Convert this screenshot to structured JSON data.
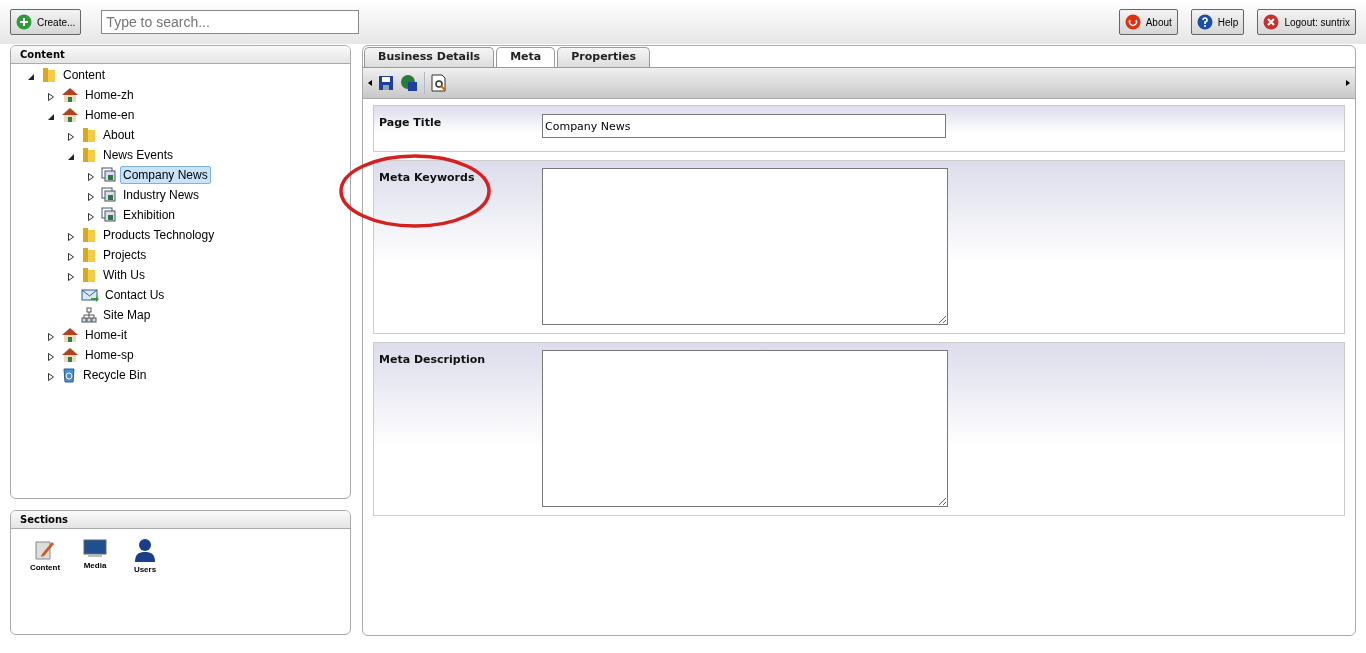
{
  "topbar": {
    "create_button": "Create...",
    "search": {
      "placeholder": "Type to search..."
    },
    "buttons": [
      {
        "label": "About",
        "kind": "about"
      },
      {
        "label": "Help",
        "kind": "help"
      },
      {
        "label": "Logout: suntrix",
        "kind": "logout"
      }
    ]
  },
  "content_panel": {
    "title": "Content",
    "tree": [
      {
        "label": "Content",
        "kind": "folder",
        "expanded": true,
        "selected": false,
        "children": [
          {
            "label": "Home-zh",
            "kind": "home",
            "expanded": false,
            "selected": false
          },
          {
            "label": "Home-en",
            "kind": "home",
            "expanded": true,
            "selected": false,
            "children": [
              {
                "label": "About",
                "kind": "folder",
                "expanded": false,
                "selected": false
              },
              {
                "label": "News Events",
                "kind": "folder",
                "expanded": true,
                "selected": false,
                "children": [
                  {
                    "label": "Company News",
                    "kind": "pages",
                    "expanded": false,
                    "selected": true
                  },
                  {
                    "label": "Industry News",
                    "kind": "pages",
                    "expanded": false,
                    "selected": false
                  },
                  {
                    "label": "Exhibition",
                    "kind": "pages",
                    "expanded": false,
                    "selected": false
                  }
                ]
              },
              {
                "label": "Products Technology",
                "kind": "folder",
                "expanded": false,
                "selected": false
              },
              {
                "label": "Projects",
                "kind": "folder",
                "expanded": false,
                "selected": false
              },
              {
                "label": "With Us",
                "kind": "folder",
                "expanded": false,
                "selected": false
              },
              {
                "label": "Contact Us",
                "kind": "mail",
                "selected": false
              },
              {
                "label": "Site Map",
                "kind": "sitemap",
                "selected": false
              }
            ]
          },
          {
            "label": "Home-it",
            "kind": "home",
            "expanded": false,
            "selected": false
          },
          {
            "label": "Home-sp",
            "kind": "home",
            "expanded": false,
            "selected": false
          },
          {
            "label": "Recycle Bin",
            "kind": "recycle",
            "expanded": false,
            "selected": false
          }
        ]
      }
    ]
  },
  "sections_panel": {
    "title": "Sections",
    "items": [
      {
        "label": "Content",
        "kind": "content"
      },
      {
        "label": "Media",
        "kind": "media"
      },
      {
        "label": "Users",
        "kind": "users"
      }
    ]
  },
  "tabs": [
    {
      "label": "Business Details",
      "selected": false
    },
    {
      "label": "Meta",
      "selected": true
    },
    {
      "label": "Properties",
      "selected": false
    }
  ],
  "fields": [
    {
      "label": "Page Title",
      "kind": "input",
      "value": "Company News",
      "highlighted": false
    },
    {
      "label": "Meta Keywords",
      "kind": "textarea",
      "highlighted": true
    },
    {
      "label": "Meta Description",
      "kind": "textarea",
      "highlighted": false
    }
  ]
}
